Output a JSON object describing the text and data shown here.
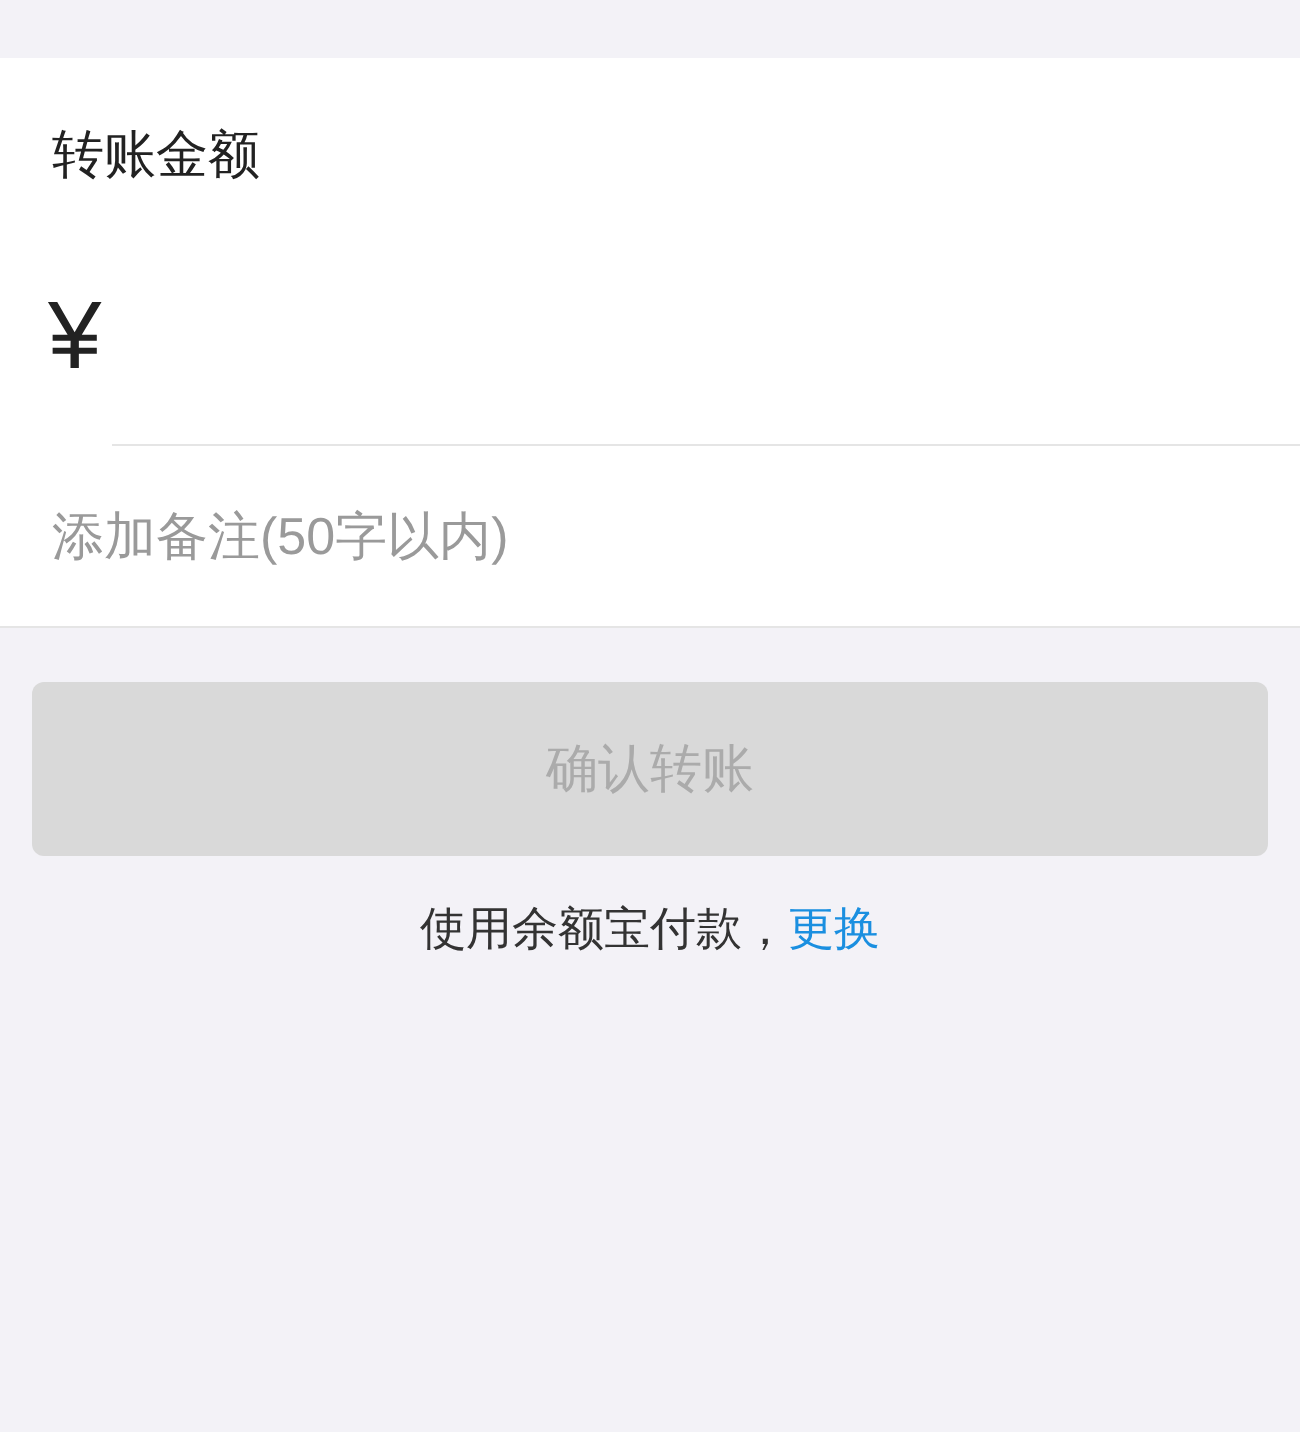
{
  "amount": {
    "label": "转账金额",
    "currency": "¥"
  },
  "note": {
    "placeholder": "添加备注(50字以内)"
  },
  "confirm_button": {
    "label": "确认转账",
    "disabled": true
  },
  "payment": {
    "text": "使用余额宝付款，",
    "link": "更换"
  }
}
